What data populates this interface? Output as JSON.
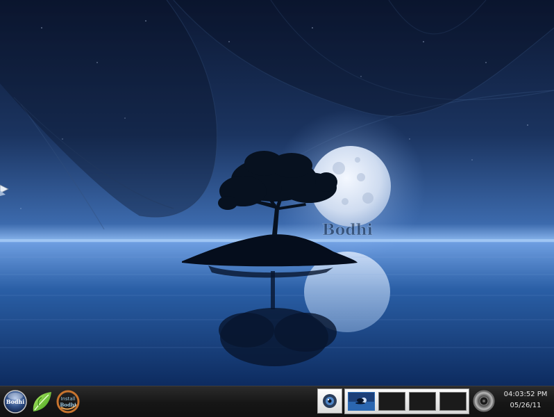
{
  "desktop": {
    "wallpaper_logo_text": "Bodhi"
  },
  "taskbar": {
    "launchers": [
      {
        "name": "start-menu",
        "label": "Bodhi"
      },
      {
        "name": "leaf-app",
        "label": ""
      },
      {
        "name": "install-bodhi",
        "label_line1": "Install",
        "label_line2": "Bodhi"
      }
    ],
    "pager": {
      "desktop_count": 4,
      "active_desktop": 1
    },
    "clock": {
      "time": "04:03:52 PM",
      "date": "05/26/11"
    }
  },
  "colors": {
    "sky_top": "#0a1530",
    "sky_horizon": "#5a8fd8",
    "water": "#1a4a8a",
    "taskbar": "#1a1a1a",
    "clock_text": "#e8e8e8"
  }
}
